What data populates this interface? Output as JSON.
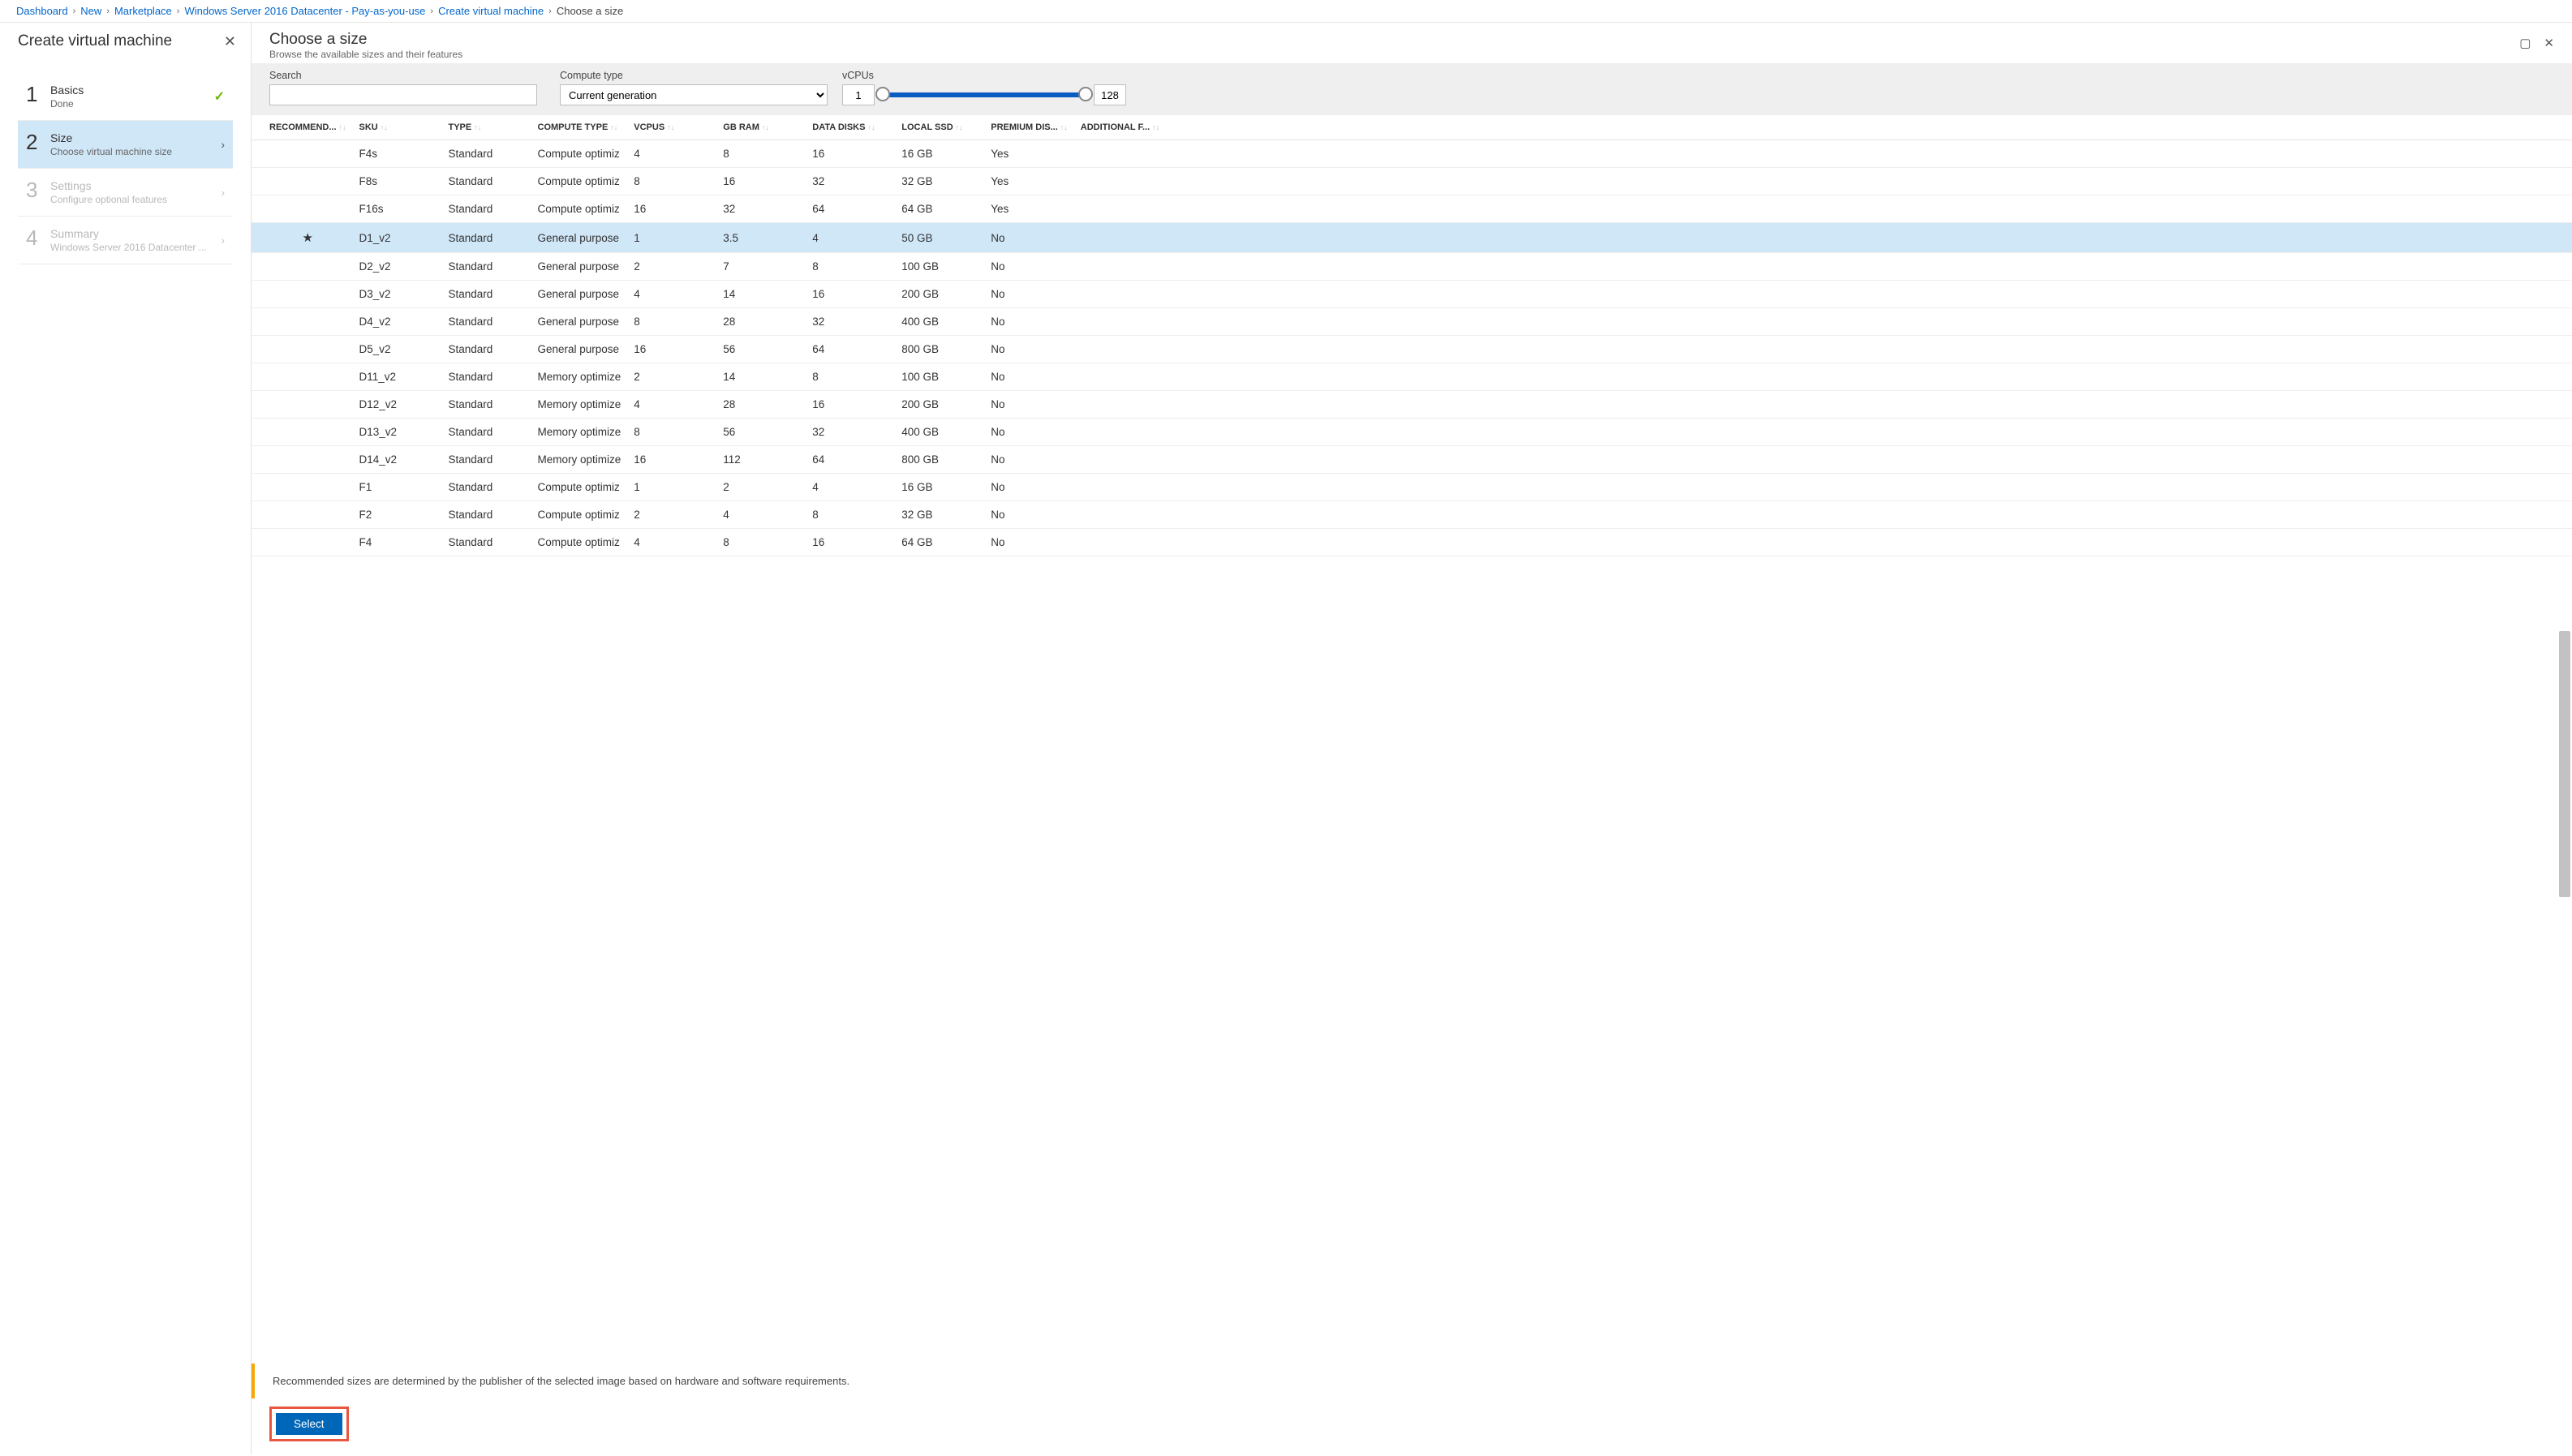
{
  "breadcrumb": {
    "items": [
      {
        "label": "Dashboard",
        "link": true
      },
      {
        "label": "New",
        "link": true
      },
      {
        "label": "Marketplace",
        "link": true
      },
      {
        "label": "Windows Server 2016 Datacenter - Pay-as-you-use",
        "link": true
      },
      {
        "label": "Create virtual machine",
        "link": true
      },
      {
        "label": "Choose a size",
        "link": false
      }
    ]
  },
  "leftPanel": {
    "title": "Create virtual machine",
    "steps": [
      {
        "num": "1",
        "label": "Basics",
        "sub": "Done",
        "state": "done"
      },
      {
        "num": "2",
        "label": "Size",
        "sub": "Choose virtual machine size",
        "state": "active"
      },
      {
        "num": "3",
        "label": "Settings",
        "sub": "Configure optional features",
        "state": "disabled"
      },
      {
        "num": "4",
        "label": "Summary",
        "sub": "Windows Server 2016 Datacenter ...",
        "state": "disabled"
      }
    ]
  },
  "rightPanel": {
    "title": "Choose a size",
    "subtitle": "Browse the available sizes and their features"
  },
  "filters": {
    "searchLabel": "Search",
    "searchValue": "",
    "computeTypeLabel": "Compute type",
    "computeTypeValue": "Current generation",
    "vcpusLabel": "vCPUs",
    "vcpusMin": "1",
    "vcpusMax": "128"
  },
  "tableHeaders": [
    "RECOMMEND...",
    "SKU",
    "TYPE",
    "COMPUTE TYPE",
    "VCPUS",
    "GB RAM",
    "DATA DISKS",
    "LOCAL SSD",
    "PREMIUM DIS...",
    "ADDITIONAL F..."
  ],
  "rows": [
    {
      "rec": "",
      "sku": "F4s",
      "type": "Standard",
      "ctype": "Compute optimiz",
      "vcpu": "4",
      "ram": "8",
      "disks": "16",
      "ssd": "16 GB",
      "prem": "Yes",
      "add": ""
    },
    {
      "rec": "",
      "sku": "F8s",
      "type": "Standard",
      "ctype": "Compute optimiz",
      "vcpu": "8",
      "ram": "16",
      "disks": "32",
      "ssd": "32 GB",
      "prem": "Yes",
      "add": ""
    },
    {
      "rec": "",
      "sku": "F16s",
      "type": "Standard",
      "ctype": "Compute optimiz",
      "vcpu": "16",
      "ram": "32",
      "disks": "64",
      "ssd": "64 GB",
      "prem": "Yes",
      "add": ""
    },
    {
      "rec": "★",
      "sku": "D1_v2",
      "type": "Standard",
      "ctype": "General purpose",
      "vcpu": "1",
      "ram": "3.5",
      "disks": "4",
      "ssd": "50 GB",
      "prem": "No",
      "add": "",
      "selected": true
    },
    {
      "rec": "",
      "sku": "D2_v2",
      "type": "Standard",
      "ctype": "General purpose",
      "vcpu": "2",
      "ram": "7",
      "disks": "8",
      "ssd": "100 GB",
      "prem": "No",
      "add": ""
    },
    {
      "rec": "",
      "sku": "D3_v2",
      "type": "Standard",
      "ctype": "General purpose",
      "vcpu": "4",
      "ram": "14",
      "disks": "16",
      "ssd": "200 GB",
      "prem": "No",
      "add": ""
    },
    {
      "rec": "",
      "sku": "D4_v2",
      "type": "Standard",
      "ctype": "General purpose",
      "vcpu": "8",
      "ram": "28",
      "disks": "32",
      "ssd": "400 GB",
      "prem": "No",
      "add": ""
    },
    {
      "rec": "",
      "sku": "D5_v2",
      "type": "Standard",
      "ctype": "General purpose",
      "vcpu": "16",
      "ram": "56",
      "disks": "64",
      "ssd": "800 GB",
      "prem": "No",
      "add": ""
    },
    {
      "rec": "",
      "sku": "D11_v2",
      "type": "Standard",
      "ctype": "Memory optimize",
      "vcpu": "2",
      "ram": "14",
      "disks": "8",
      "ssd": "100 GB",
      "prem": "No",
      "add": ""
    },
    {
      "rec": "",
      "sku": "D12_v2",
      "type": "Standard",
      "ctype": "Memory optimize",
      "vcpu": "4",
      "ram": "28",
      "disks": "16",
      "ssd": "200 GB",
      "prem": "No",
      "add": ""
    },
    {
      "rec": "",
      "sku": "D13_v2",
      "type": "Standard",
      "ctype": "Memory optimize",
      "vcpu": "8",
      "ram": "56",
      "disks": "32",
      "ssd": "400 GB",
      "prem": "No",
      "add": ""
    },
    {
      "rec": "",
      "sku": "D14_v2",
      "type": "Standard",
      "ctype": "Memory optimize",
      "vcpu": "16",
      "ram": "112",
      "disks": "64",
      "ssd": "800 GB",
      "prem": "No",
      "add": ""
    },
    {
      "rec": "",
      "sku": "F1",
      "type": "Standard",
      "ctype": "Compute optimiz",
      "vcpu": "1",
      "ram": "2",
      "disks": "4",
      "ssd": "16 GB",
      "prem": "No",
      "add": ""
    },
    {
      "rec": "",
      "sku": "F2",
      "type": "Standard",
      "ctype": "Compute optimiz",
      "vcpu": "2",
      "ram": "4",
      "disks": "8",
      "ssd": "32 GB",
      "prem": "No",
      "add": ""
    },
    {
      "rec": "",
      "sku": "F4",
      "type": "Standard",
      "ctype": "Compute optimiz",
      "vcpu": "4",
      "ram": "8",
      "disks": "16",
      "ssd": "64 GB",
      "prem": "No",
      "add": ""
    }
  ],
  "footerNote": "Recommended sizes are determined by the publisher of the selected image based on hardware and software requirements.",
  "selectButton": "Select"
}
